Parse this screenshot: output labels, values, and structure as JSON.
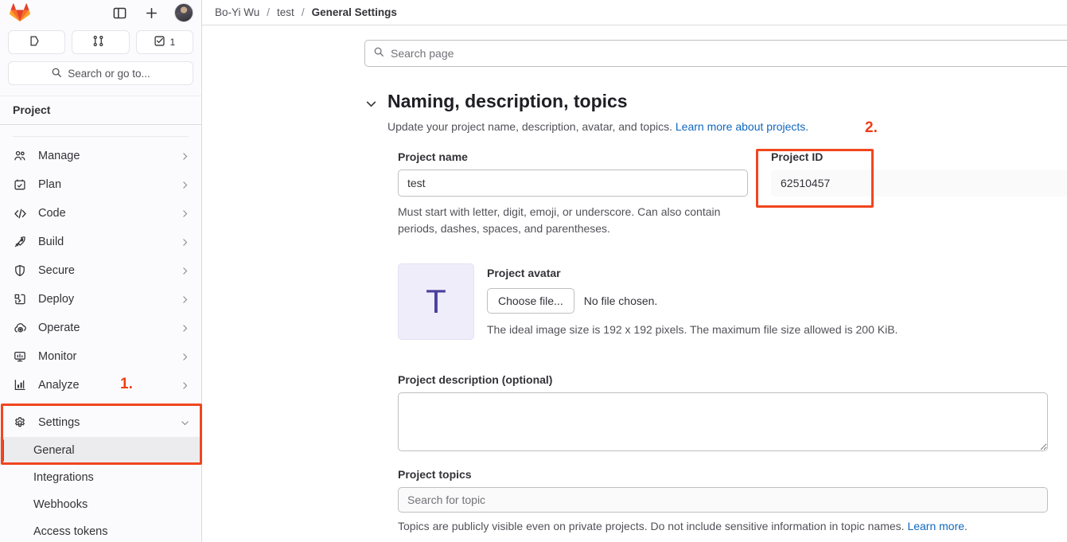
{
  "topbar": {
    "logo_icon": "gitlab-logo-icon",
    "sidebar_toggle_icon": "sidebar-toggle-icon",
    "new_icon": "plus-icon",
    "avatar_icon": "user-avatar"
  },
  "counts": [
    {
      "icon": "issues-icon",
      "label": ""
    },
    {
      "icon": "merge-requests-icon",
      "label": ""
    },
    {
      "icon": "todo-icon",
      "label": "1"
    }
  ],
  "sidebar": {
    "search_placeholder": "Search or go to...",
    "search_icon": "search-icon",
    "context_label": "Project",
    "items": [
      {
        "label": "Manage",
        "icon": "users-icon"
      },
      {
        "label": "Plan",
        "icon": "calendar-icon"
      },
      {
        "label": "Code",
        "icon": "code-icon"
      },
      {
        "label": "Build",
        "icon": "rocket-icon"
      },
      {
        "label": "Secure",
        "icon": "shield-icon"
      },
      {
        "label": "Deploy",
        "icon": "deploy-icon"
      },
      {
        "label": "Operate",
        "icon": "cloud-icon"
      },
      {
        "label": "Monitor",
        "icon": "monitor-icon"
      },
      {
        "label": "Analyze",
        "icon": "chart-icon"
      }
    ],
    "settings": {
      "label": "Settings",
      "icon": "gear-icon"
    },
    "settings_children": [
      {
        "label": "General",
        "active": true
      },
      {
        "label": "Integrations",
        "active": false
      },
      {
        "label": "Webhooks",
        "active": false
      },
      {
        "label": "Access tokens",
        "active": false
      }
    ]
  },
  "breadcrumb": {
    "owner": "Bo-Yi Wu",
    "project": "test",
    "current": "General Settings",
    "separator": "/"
  },
  "search_page": {
    "placeholder": "Search page",
    "icon": "search-icon"
  },
  "section": {
    "title": "Naming, description, topics",
    "description": "Update your project name, description, avatar, and topics.",
    "learn_more": "Learn more about projects.",
    "collapse_icon": "chevron-down-icon"
  },
  "project_name": {
    "label": "Project name",
    "value": "test",
    "help": "Must start with letter, digit, emoji, or underscore. Can also contain periods, dashes, spaces, and parentheses."
  },
  "project_id": {
    "label": "Project ID",
    "value": "62510457"
  },
  "avatar": {
    "label": "Project avatar",
    "initial": "T",
    "choose_button": "Choose file...",
    "no_file": "No file chosen.",
    "help": "The ideal image size is 192 x 192 pixels. The maximum file size allowed is 200 KiB."
  },
  "description": {
    "label": "Project description (optional)",
    "value": ""
  },
  "topics": {
    "label": "Project topics",
    "placeholder": "Search for topic",
    "help": "Topics are publicly visible even on private projects. Do not include sensitive information in topic names.",
    "learn_more": "Learn more",
    "help_end": "."
  },
  "annotations": {
    "accent_color": "#f0461e",
    "marker_1": "1.",
    "marker_2": "2."
  }
}
